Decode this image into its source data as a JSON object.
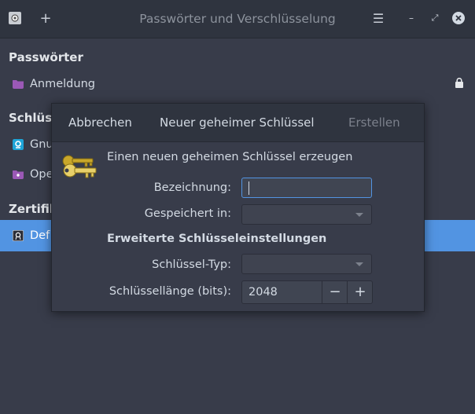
{
  "window": {
    "title": "Passwörter und Verschlüsselung",
    "buttons": {
      "menu": "☰",
      "minimize": "–",
      "restore": "⤢",
      "close": "✕",
      "new": "+"
    }
  },
  "sidebar": {
    "sections": [
      {
        "header": "Passwörter",
        "items": [
          {
            "label": "Anmeldung",
            "icon": "folder-icon",
            "color": "#9b59b6",
            "locked": true
          }
        ]
      },
      {
        "header": "Schlüss",
        "items": [
          {
            "label": "Gnu",
            "icon": "gnupg-key-icon",
            "color": "#1ea5d8"
          },
          {
            "label": "Ope",
            "icon": "folder-icon",
            "color": "#9b59b6"
          }
        ]
      },
      {
        "header": "Zertifik",
        "items": [
          {
            "label": "Def",
            "icon": "certificate-icon",
            "selected": true
          }
        ]
      }
    ],
    "selected_color": "#5294e2"
  },
  "dialog": {
    "cancel_label": "Abbrechen",
    "title": "Neuer geheimer Schlüssel",
    "create_label": "Erstellen",
    "description": "Einen neuen geheimen Schlüssel erzeugen",
    "name_label": "Bezeichnung:",
    "name_value": "",
    "stored_in_label": "Gespeichert in:",
    "stored_in_value": "",
    "advanced_heading": "Erweiterte Schlüsseleinstellungen",
    "key_type_label": "Schlüssel-Typ:",
    "key_type_value": "",
    "key_length_label": "Schlüssellänge (bits):",
    "key_length_value": "2048",
    "minus": "−",
    "plus": "+"
  }
}
